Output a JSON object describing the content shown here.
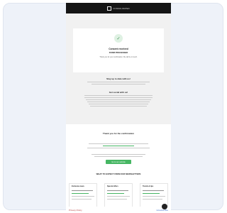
{
  "header": {
    "brand": "CONSOLIDATED"
  },
  "hero": {
    "title": "Consent received",
    "subtitle": "FORM PROCESSED",
    "body": "Thank you for your confirmation. We will be in touch."
  },
  "section1": {
    "heading": "Stay up to date with us!"
  },
  "section2": {
    "heading": "Get social with us!"
  },
  "promo": {
    "heading": "Thank you for the confirmation",
    "cta": "Go to our website"
  },
  "benefits": {
    "heading": "WHAT TO EXPECT FROM OUR NEWSLETTERS",
    "columns": [
      {
        "title": "Exclusive news"
      },
      {
        "title": "Special offers"
      },
      {
        "title": "Trends & tips"
      }
    ]
  },
  "footer": {
    "left": "Privacy Policy",
    "right": "Unsubscribe"
  }
}
